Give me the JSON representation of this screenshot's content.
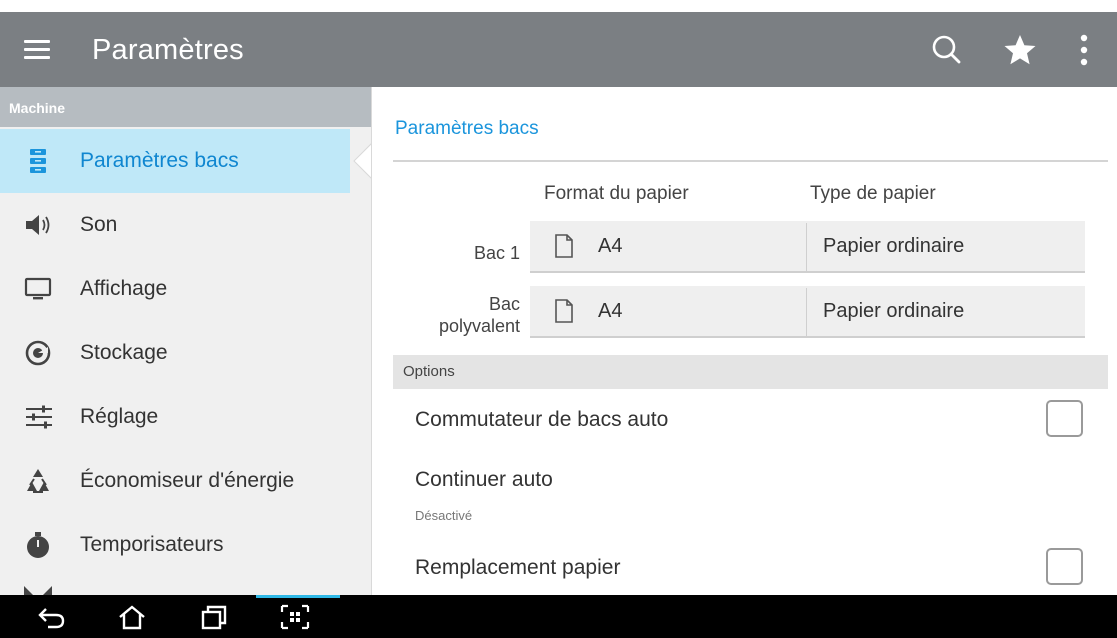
{
  "app_bar": {
    "title": "Paramètres",
    "icons": [
      "menu-icon",
      "search-icon",
      "star-icon",
      "overflow-menu-icon"
    ]
  },
  "sidebar": {
    "section_label": "Machine",
    "items": [
      {
        "label": "Paramètres bacs",
        "icon": "tray-icon",
        "active": true
      },
      {
        "label": "Son",
        "icon": "speaker-icon"
      },
      {
        "label": "Affichage",
        "icon": "monitor-icon"
      },
      {
        "label": "Stockage",
        "icon": "storage-icon"
      },
      {
        "label": "Réglage",
        "icon": "sliders-icon"
      },
      {
        "label": "Économiseur d'énergie",
        "icon": "recycle-icon"
      },
      {
        "label": "Temporisateurs",
        "icon": "stopwatch-icon"
      }
    ]
  },
  "content": {
    "section_title": "Paramètres bacs",
    "columns": {
      "format": "Format du papier",
      "type": "Type de papier"
    },
    "trays": [
      {
        "label": "Bac 1",
        "format": "A4",
        "type": "Papier ordinaire"
      },
      {
        "label": "Bac polyvalent",
        "format": "A4",
        "type": "Papier ordinaire"
      }
    ],
    "options_header": "Options",
    "options": [
      {
        "label": "Commutateur de bacs auto",
        "checked": false
      },
      {
        "label": "Continuer auto",
        "sub": "Désactivé"
      },
      {
        "label": "Remplacement papier",
        "checked": false
      }
    ]
  },
  "colors": {
    "app_bar": "#7b7f83",
    "accent": "#1b95dc",
    "active_item_bg": "#bfe8f8",
    "sidebar_bg": "#f0f0f0"
  },
  "system_nav": [
    "back-icon",
    "home-icon",
    "recent-apps-icon",
    "screenshot-icon"
  ]
}
